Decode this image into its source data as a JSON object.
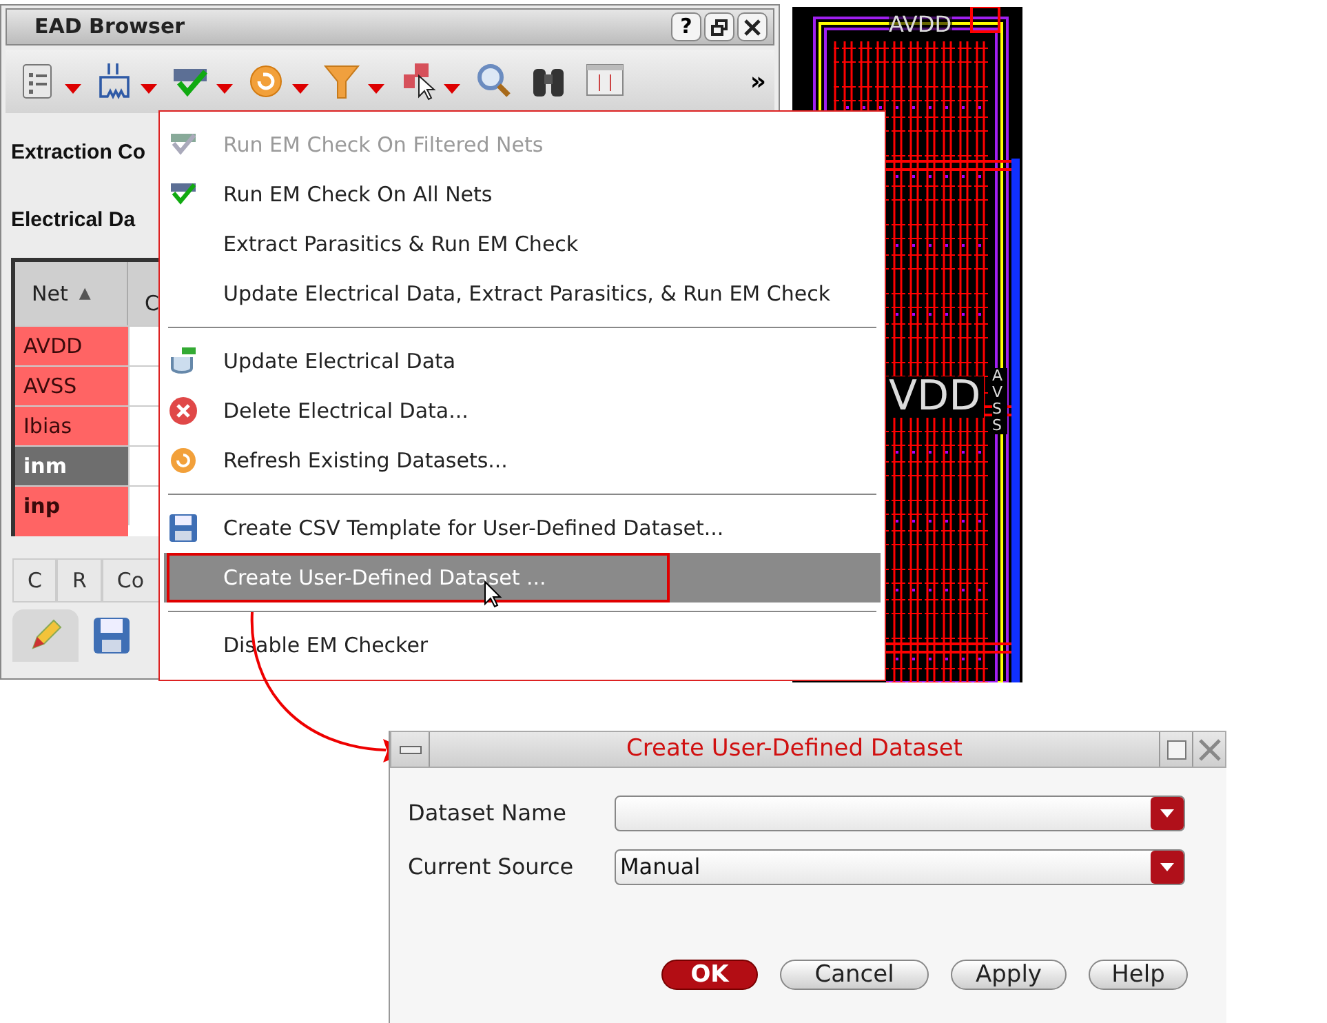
{
  "browser": {
    "title": "EAD Browser",
    "help_button": "?",
    "overflow_button": "»",
    "labels": [
      "Extraction Co",
      "Electrical Da"
    ],
    "table": {
      "columns": [
        {
          "label": "Net",
          "sort_indicator": "▲"
        },
        {
          "label": "C"
        }
      ],
      "rows": [
        {
          "net": "AVDD",
          "flagged": true,
          "selected": false,
          "bold": false
        },
        {
          "net": "AVSS",
          "flagged": true,
          "selected": false,
          "bold": false
        },
        {
          "net": "Ibias",
          "flagged": true,
          "selected": false,
          "bold": false
        },
        {
          "net": "inm",
          "flagged": false,
          "selected": true,
          "bold": true
        },
        {
          "net": "inp",
          "flagged": true,
          "selected": false,
          "bold": true
        }
      ]
    },
    "tabs": [
      "C",
      "R",
      "Co"
    ]
  },
  "layout_view": {
    "labels": [
      "AVDD",
      "VDD",
      "AVSS"
    ]
  },
  "menu": {
    "items": [
      {
        "kind": "item",
        "label": "Run EM Check On Filtered Nets",
        "disabled": true,
        "selected": false
      },
      {
        "kind": "item",
        "label": "Run EM Check On All Nets",
        "disabled": false,
        "selected": false
      },
      {
        "kind": "item",
        "label": "Extract Parasitics & Run EM Check",
        "disabled": false,
        "selected": false
      },
      {
        "kind": "item",
        "label": "Update Electrical Data, Extract Parasitics, & Run EM Check",
        "disabled": false,
        "selected": false
      },
      {
        "kind": "separator"
      },
      {
        "kind": "item",
        "label": "Update Electrical Data",
        "disabled": false,
        "selected": false
      },
      {
        "kind": "item",
        "label": "Delete Electrical Data...",
        "disabled": false,
        "selected": false
      },
      {
        "kind": "item",
        "label": "Refresh Existing Datasets...",
        "disabled": false,
        "selected": false
      },
      {
        "kind": "separator"
      },
      {
        "kind": "item",
        "label": "Create CSV Template for User-Defined Dataset...",
        "disabled": false,
        "selected": false
      },
      {
        "kind": "item",
        "label": "Create User-Defined Dataset ...",
        "disabled": false,
        "selected": true
      },
      {
        "kind": "separator"
      },
      {
        "kind": "item",
        "label": "Disable EM Checker",
        "disabled": false,
        "selected": false
      }
    ]
  },
  "dialog": {
    "title": "Create User-Defined Dataset",
    "fields": [
      {
        "label": "Dataset Name"
      },
      {
        "label": "Current Source",
        "value": "Manual"
      }
    ],
    "buttons": [
      {
        "label": "OK",
        "default": true
      },
      {
        "label": "Cancel",
        "default": false
      },
      {
        "label": "Apply",
        "default": false
      },
      {
        "label": "Help",
        "default": false
      }
    ]
  }
}
